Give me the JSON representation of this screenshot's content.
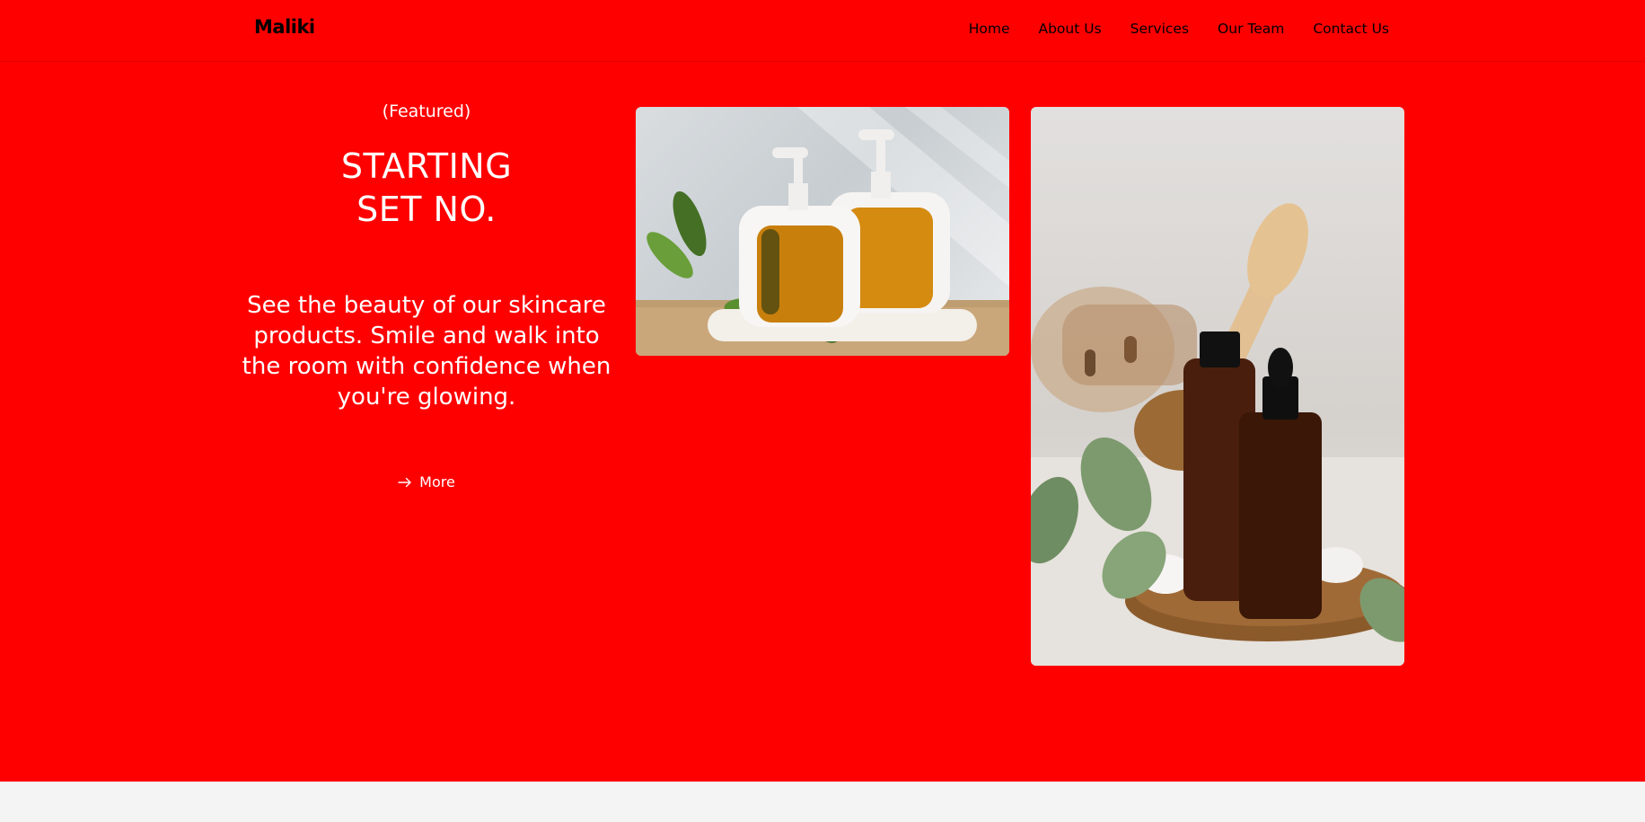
{
  "header": {
    "logo": "Maliki",
    "nav": [
      "Home",
      "About Us",
      "Services",
      "Our Team",
      "Contact Us"
    ]
  },
  "hero": {
    "featured": "(Featured)",
    "title_line1": "STARTING",
    "title_line2": "SET NO.",
    "description": "See the beauty of our skincare products. Smile and walk into the room with confidence when you're glowing.",
    "cta_label": "More",
    "cta_icon": "arrow-right-icon"
  },
  "colors": {
    "hero_background": "#ff0000",
    "footer_background": "#f4f4f4",
    "text_light": "#ffffff",
    "text_dark": "#000000"
  }
}
